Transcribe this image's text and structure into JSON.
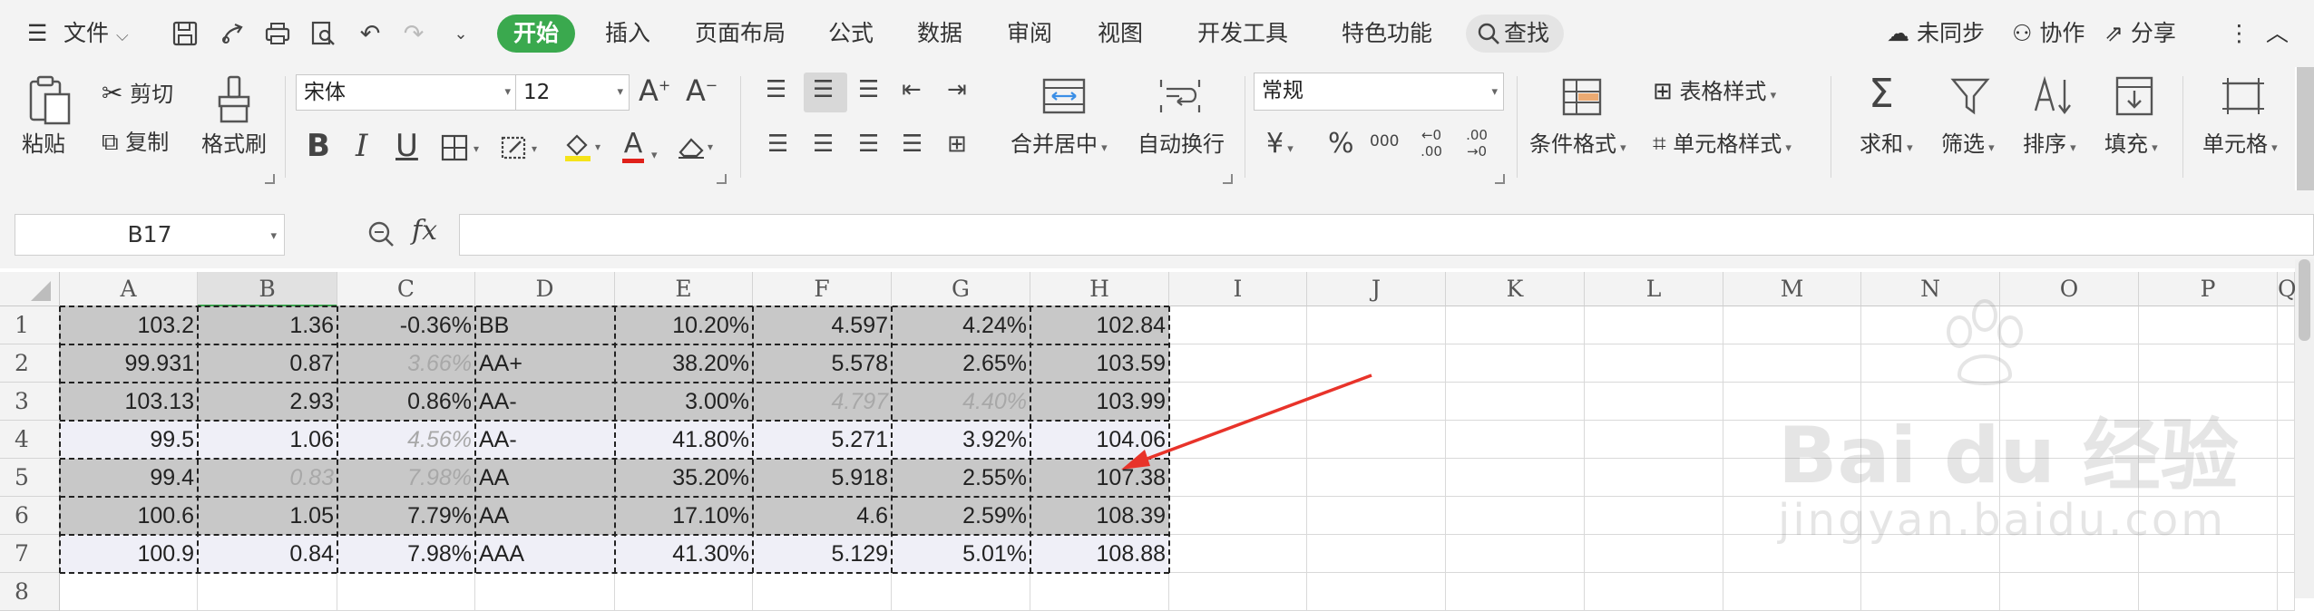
{
  "menu": {
    "file_label": "文件",
    "tabs": [
      "开始",
      "插入",
      "页面布局",
      "公式",
      "数据",
      "审阅",
      "视图",
      "开发工具",
      "特色功能"
    ],
    "active_tab": "开始",
    "search_label": "查找",
    "sync_label": "未同步",
    "collab_label": "协作",
    "share_label": "分享"
  },
  "ribbon": {
    "paste": "粘贴",
    "cut": "剪切",
    "copy": "复制",
    "format_painter": "格式刷",
    "font_name": "宋体",
    "font_size": "12",
    "bold": "B",
    "italic": "I",
    "underline": "U",
    "font_color_glyph": "A",
    "merge_center": "合并居中",
    "wrap_text": "自动换行",
    "number_format": "常规",
    "currency_glyph": "¥",
    "percent_glyph": "%",
    "thousands_glyph": "000",
    "inc_decimal_glyph": "←0 .00",
    "dec_decimal_glyph": ".00 →0",
    "conditional_format": "条件格式",
    "table_style": "表格样式",
    "cell_style": "单元格样式",
    "sum": "求和",
    "filter": "筛选",
    "sort": "排序",
    "fill": "填充",
    "cells": "单元格"
  },
  "formula_bar": {
    "name_box": "B17",
    "fx_label": "fx",
    "content": ""
  },
  "sheet": {
    "columns": [
      "A",
      "B",
      "C",
      "D",
      "E",
      "F",
      "G",
      "H",
      "I",
      "J",
      "K",
      "L",
      "M",
      "N",
      "O",
      "P",
      "Q"
    ],
    "selected_column": "B",
    "row_numbers": [
      "1",
      "2",
      "3",
      "4",
      "5",
      "6",
      "7",
      "8"
    ],
    "rows": [
      [
        "103.2",
        "1.36",
        "-0.36%",
        "BB",
        "10.20%",
        "4.597",
        "4.24%",
        "102.84"
      ],
      [
        "99.931",
        "0.87",
        "3.66%",
        "AA+",
        "38.20%",
        "5.578",
        "2.65%",
        "103.59"
      ],
      [
        "103.13",
        "2.93",
        "0.86%",
        "AA-",
        "3.00%",
        "4.797",
        "4.40%",
        "103.99"
      ],
      [
        "99.5",
        "1.06",
        "4.56%",
        "AA-",
        "41.80%",
        "5.271",
        "3.92%",
        "104.06"
      ],
      [
        "99.4",
        "0.83",
        "7.98%",
        "AA",
        "35.20%",
        "5.918",
        "2.55%",
        "107.38"
      ],
      [
        "100.6",
        "1.05",
        "7.79%",
        "AA",
        "17.10%",
        "4.6",
        "2.59%",
        "108.39"
      ],
      [
        "100.9",
        "0.84",
        "7.98%",
        "AAA",
        "41.30%",
        "5.129",
        "5.01%",
        "108.88"
      ]
    ],
    "row_fills": [
      "#c8c8c8",
      "#c8c8c8",
      "#c8c8c8",
      "#efeff7",
      "#c8c8c8",
      "#c8c8c8",
      "#efeff7"
    ],
    "dimmed_cells": [
      [
        1,
        2
      ],
      [
        2,
        5
      ],
      [
        2,
        6
      ],
      [
        3,
        2
      ],
      [
        4,
        1
      ],
      [
        4,
        2
      ]
    ]
  },
  "watermark": {
    "logo_text": "Bai du 经验",
    "url_text": "jingyan.baidu.com"
  },
  "annotation": {
    "arrow_color": "#e8332a"
  }
}
